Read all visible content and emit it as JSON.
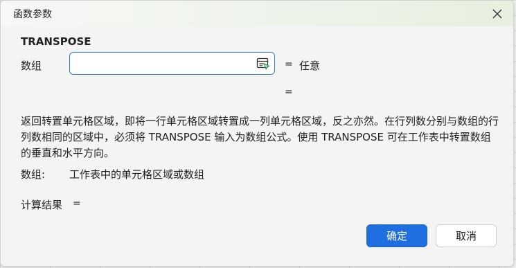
{
  "dialog": {
    "title": "函数参数",
    "function_name": "TRANSPOSE",
    "argument": {
      "label": "数组",
      "value": "",
      "placeholder": "",
      "eq": "=",
      "result_value": "任意"
    },
    "second_eq": "=",
    "description": "返回转置单元格区域，即将一行单元格区域转置成一列单元格区域，反之亦然。在行列数分别与数组的行列数相同的区域中，必须将 TRANSPOSE 输入为数组公式。使用 TRANSPOSE 可在工作表中转置数组的垂直和水平方向。",
    "arg_help": {
      "label": "数组:",
      "text": "工作表中的单元格区域或数组"
    },
    "result": {
      "label": "计算结果",
      "eq": "="
    },
    "buttons": {
      "ok": "确定",
      "cancel": "取消"
    }
  },
  "colors": {
    "accent": "#1f6fe0",
    "input_border": "#3b78d8",
    "picker_icon": "#2e9b57"
  },
  "icons": {
    "close": "close-icon",
    "range_picker": "range-select-icon"
  }
}
